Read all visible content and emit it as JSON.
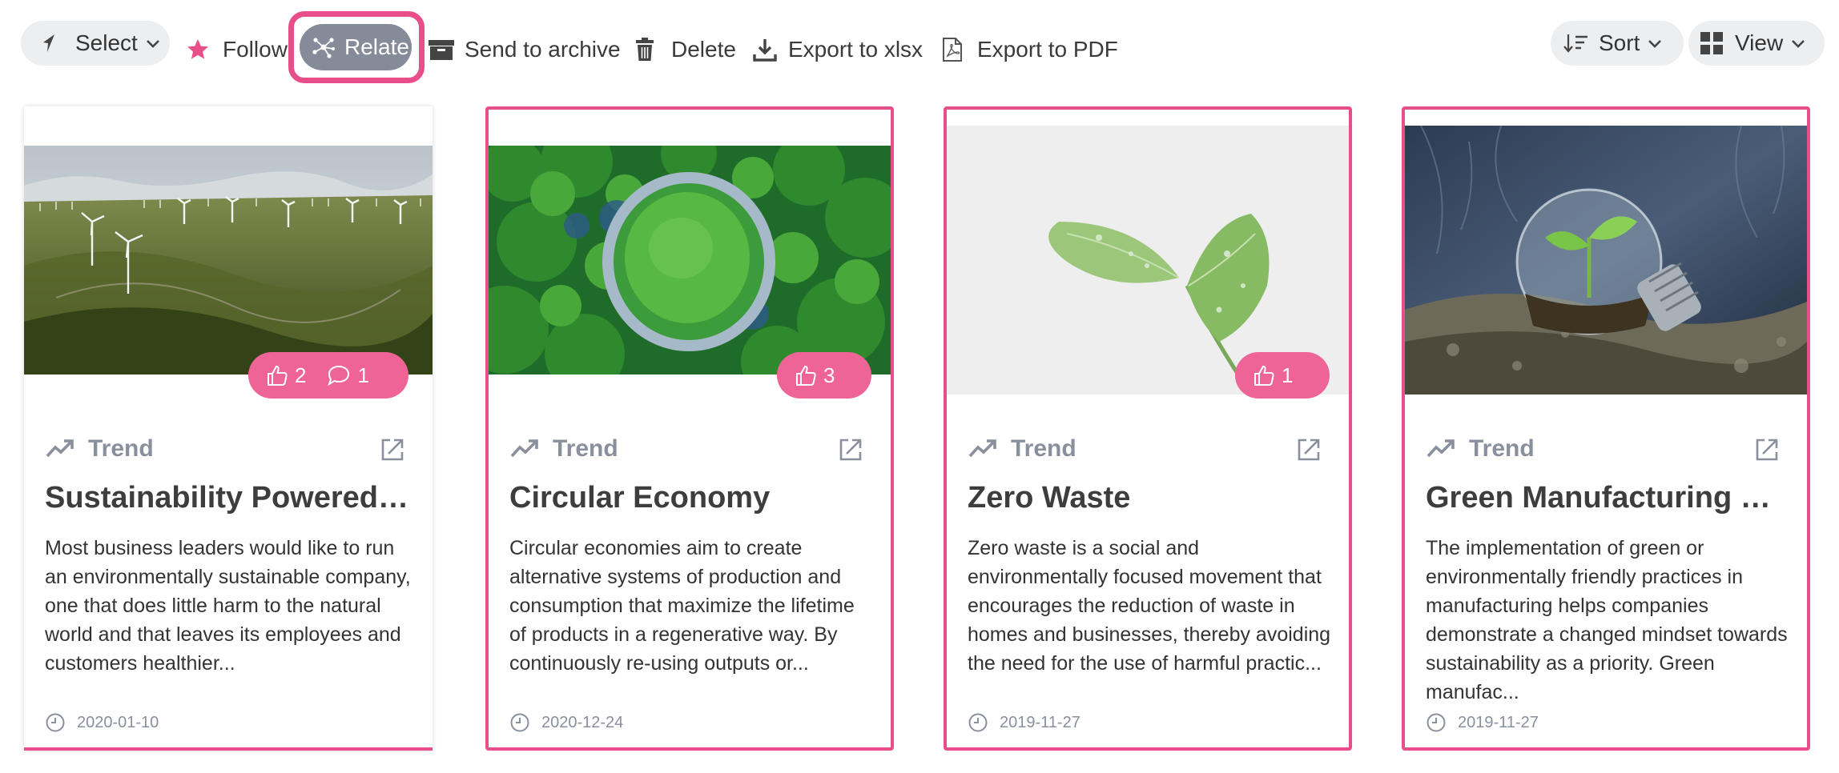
{
  "toolbar": {
    "select_label": "Select",
    "follow_label": "Follow",
    "relate_label": "Relate",
    "archive_label": "Send to archive",
    "delete_label": "Delete",
    "export_xlsx_label": "Export to xlsx",
    "export_pdf_label": "Export to PDF",
    "sort_label": "Sort",
    "view_label": "View"
  },
  "colors": {
    "accent": "#e84e8a",
    "badge": "#ee6497",
    "relate_bg": "#858b99",
    "pill_bg": "#eceef0",
    "muted": "#8a8f9e"
  },
  "cards": [
    {
      "type": "Trend",
      "title": "Sustainability Powered ...",
      "description": "Most business leaders would like to run an environmentally sustainable company, one that does little harm to the natural world and that leaves its employees and customers healthier...",
      "date": "2020-01-10",
      "likes": "2",
      "comments": "1",
      "image": "wind-farm-photo"
    },
    {
      "type": "Trend",
      "title": "Circular Economy",
      "description": "Circular economies aim to create alternative systems of production and consumption that maximize the lifetime of products in a regenerative way. By continuously re-using outputs or...",
      "date": "2020-12-24",
      "likes": "3",
      "image": "forest-circle-photo"
    },
    {
      "type": "Trend",
      "title": "Zero Waste",
      "description": "Zero waste is a social and environmentally focused movement that encourages the reduction of waste in homes and businesses, thereby avoiding the need for the use of harmful practic...",
      "date": "2019-11-27",
      "likes": "1",
      "image": "green-leaf-photo"
    },
    {
      "type": "Trend",
      "title": "Green Manufacturing G...",
      "description": "The implementation of green or environmentally friendly practices in manufacturing helps companies demonstrate a changed mindset towards sustainability as a priority. Green manufac...",
      "date": "2019-11-27",
      "image": "plant-in-bulb-photo"
    }
  ]
}
